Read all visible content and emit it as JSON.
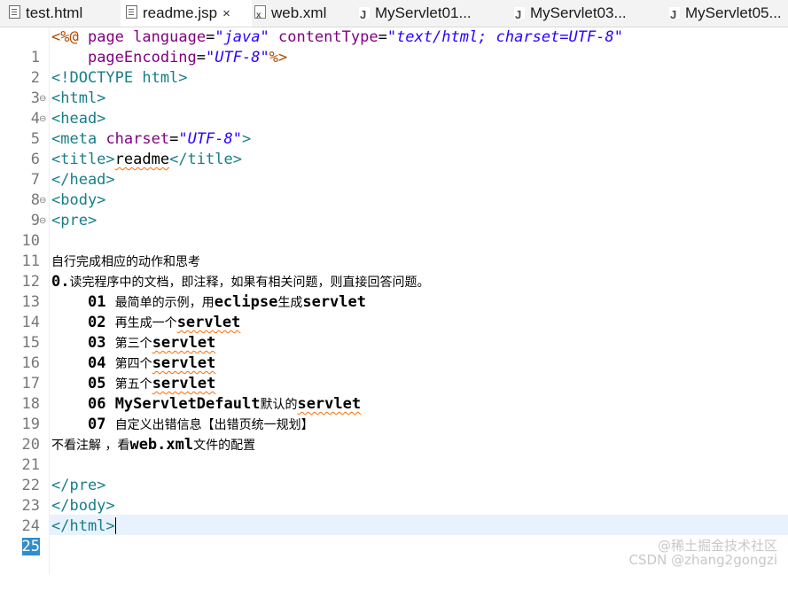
{
  "tabs": [
    {
      "label": "test.html",
      "icon": "html-file-icon",
      "active": false
    },
    {
      "label": "readme.jsp",
      "icon": "jsp-file-icon",
      "active": true
    },
    {
      "label": "web.xml",
      "icon": "xml-file-icon",
      "active": false
    },
    {
      "label": "MyServlet01...",
      "icon": "java-file-icon",
      "active": false
    },
    {
      "label": "MyServlet03...",
      "icon": "java-file-icon",
      "active": false
    },
    {
      "label": "MyServlet05...",
      "icon": "java-file-icon",
      "active": false
    }
  ],
  "active_tab_close": "×",
  "editor": {
    "line_numbers": [
      "1",
      "2",
      "3",
      "4",
      "5",
      "6",
      "7",
      "8",
      "9",
      "10",
      "11",
      "12",
      "13",
      "14",
      "15",
      "16",
      "17",
      "18",
      "19",
      "20",
      "21",
      "22",
      "23",
      "24",
      "25"
    ],
    "current_line": "25",
    "lines": {
      "l1": {
        "open": "<%@",
        "a1": "page",
        "a2": "language",
        "eq": "=",
        "v1": "\"java\"",
        "a3": "contentType",
        "v2": "\"text/html; charset=UTF-8\""
      },
      "l2": {
        "a1": "pageEncoding",
        "eq": "=",
        "v1": "\"UTF-8\"",
        "close": "%>"
      },
      "l3": "<!DOCTYPE html>",
      "l4": "<html>",
      "l5": "<head>",
      "l6": {
        "open": "<meta",
        "attr": "charset",
        "eq": "=",
        "val": "\"UTF-8\"",
        "close": ">"
      },
      "l7": {
        "open": "<title>",
        "text": "readme",
        "close": "</title>"
      },
      "l8": "</head>",
      "l9": "<body>",
      "l10": "<pre>",
      "l11": "",
      "l12": "自行完成相应的动作和思考",
      "l13": {
        "num": "0.",
        "text": "读完程序中的文档，即注释，如果有相关问题，则直接回答问题。"
      },
      "l14": {
        "num": "01",
        "t1": "最简单的示例，用",
        "w1": "eclipse",
        "t2": "生成",
        "w2": "servlet"
      },
      "l15": {
        "num": "02",
        "t1": "再生成一个",
        "w1": "servlet"
      },
      "l16": {
        "num": "03",
        "t1": "第三个",
        "w1": "servlet"
      },
      "l17": {
        "num": "04",
        "t1": "第四个",
        "w1": "servlet"
      },
      "l18": {
        "num": "05",
        "t1": "第五个",
        "w1": "servlet"
      },
      "l19": {
        "num": "06",
        "w1": "MyServletDefault",
        "t1": "默认的",
        "w2": "servlet"
      },
      "l20": {
        "num": "07",
        "t1": "自定义出错信息【出错页统一规划】"
      },
      "l21": {
        "t1": "不看注解 ，看",
        "w1": "web.xml",
        "t2": "文件的配置"
      },
      "l22": "",
      "l23": "</pre>",
      "l24": "</body>",
      "l25": "</html>"
    }
  },
  "watermark": {
    "line1": "@稀土掘金技术社区",
    "line2": "CSDN @zhang2gongzi"
  }
}
